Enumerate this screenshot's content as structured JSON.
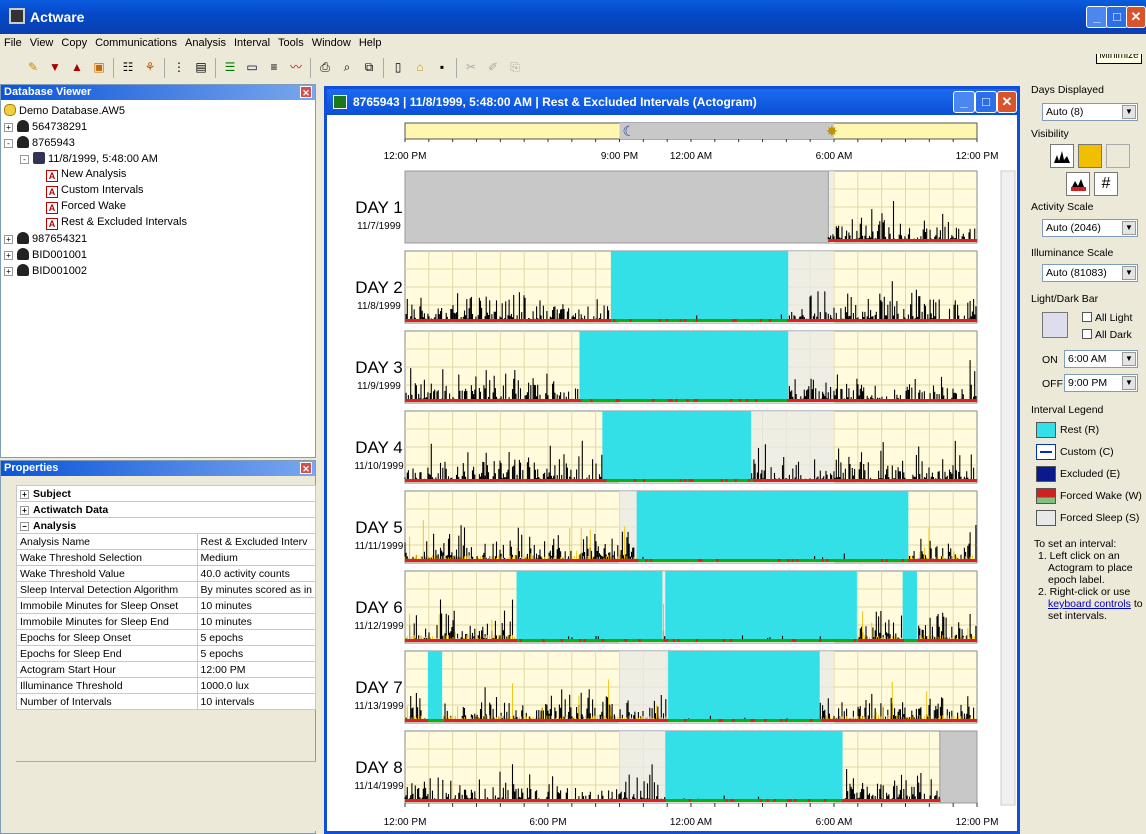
{
  "app": {
    "title": "Actware",
    "tooltip": "Minimize"
  },
  "menu": [
    "File",
    "View",
    "Copy",
    "Communications",
    "Analysis",
    "Interval",
    "Tools",
    "Window",
    "Help"
  ],
  "toolbar_icons": [
    "subject-icon",
    "download-icon",
    "upload-icon",
    "battery-icon",
    "properties-icon",
    "filter-icon",
    "tree-icon",
    "report-icon",
    "actogram-icon",
    "window-icon",
    "list-icon",
    "graph-icon",
    "print-icon",
    "print-preview-icon",
    "copy-icon",
    "new-icon",
    "open-icon",
    "save-icon",
    "cut-icon",
    "edit-icon",
    "paste-icon"
  ],
  "database_viewer": {
    "title": "Database Viewer",
    "root": "Demo Database.AW5",
    "items": [
      {
        "label": "564738291",
        "level": 1,
        "expander": "+"
      },
      {
        "label": "8765943",
        "level": 1,
        "expander": "-"
      },
      {
        "label": "11/8/1999, 5:48:00 AM",
        "level": 2,
        "expander": "-"
      },
      {
        "label": "New Analysis",
        "level": 3
      },
      {
        "label": "Custom Intervals",
        "level": 3
      },
      {
        "label": "Forced Wake",
        "level": 3
      },
      {
        "label": "Rest & Excluded Intervals",
        "level": 3,
        "selected": true
      },
      {
        "label": "987654321",
        "level": 1,
        "expander": "+"
      },
      {
        "label": "BID001001",
        "level": 1,
        "expander": "+"
      },
      {
        "label": "BID001002",
        "level": 1,
        "expander": "+"
      }
    ]
  },
  "properties": {
    "title": "Properties",
    "sections": [
      "Subject",
      "Actiwatch Data",
      "Analysis"
    ],
    "rows": [
      [
        "Analysis Name",
        "Rest & Excluded Interv"
      ],
      [
        "Wake Threshold Selection",
        "Medium"
      ],
      [
        "Wake Threshold Value",
        "40.0 activity counts"
      ],
      [
        "Sleep Interval Detection Algorithm",
        "By minutes scored as in"
      ],
      [
        "Immobile Minutes for Sleep Onset",
        "10 minutes"
      ],
      [
        "Immobile Minutes for Sleep End",
        "10 minutes"
      ],
      [
        "Epochs for Sleep Onset",
        "5 epochs"
      ],
      [
        "Epochs for Sleep End",
        "5 epochs"
      ],
      [
        "Actogram Start Hour",
        "12:00 PM"
      ],
      [
        "Illuminance Threshold",
        "1000.0 lux"
      ],
      [
        "Number of Intervals",
        "10 intervals"
      ]
    ]
  },
  "actogram": {
    "title": "8765943 | 11/8/1999, 5:48:00 AM | Rest & Excluded Intervals (Actogram)",
    "top_ticks": [
      "12:00 PM",
      "9:00 PM",
      "12:00 AM",
      "6:00 AM",
      "12:00 PM"
    ],
    "bottom_ticks": [
      "12:00 PM",
      "6:00 PM",
      "12:00 AM",
      "6:00 AM",
      "12:00 PM"
    ],
    "days": [
      {
        "label": "DAY 1",
        "date": "11/7/1999",
        "excluded": [
          [
            0,
            0.74
          ]
        ],
        "rest": []
      },
      {
        "label": "DAY 2",
        "date": "11/8/1999",
        "excluded": [],
        "rest": [
          [
            0.36,
            0.67
          ]
        ]
      },
      {
        "label": "DAY 3",
        "date": "11/9/1999",
        "excluded": [],
        "rest": [
          [
            0.305,
            0.67
          ]
        ]
      },
      {
        "label": "DAY 4",
        "date": "11/10/1999",
        "excluded": [],
        "rest": [
          [
            0.345,
            0.605
          ]
        ]
      },
      {
        "label": "DAY 5",
        "date": "11/11/1999",
        "excluded": [],
        "rest": [
          [
            0.405,
            0.88
          ]
        ]
      },
      {
        "label": "DAY 6",
        "date": "11/12/1999",
        "excluded": [],
        "rest": [
          [
            0.195,
            0.45
          ],
          [
            0.455,
            0.79
          ],
          [
            0.87,
            0.895
          ]
        ]
      },
      {
        "label": "DAY 7",
        "date": "11/13/1999",
        "excluded": [],
        "rest": [
          [
            0.04,
            0.065
          ],
          [
            0.46,
            0.725
          ]
        ]
      },
      {
        "label": "DAY 8",
        "date": "11/14/1999",
        "excluded": [
          [
            0.935,
            1.0
          ]
        ],
        "rest": [
          [
            0.455,
            0.765
          ]
        ]
      }
    ]
  },
  "right_panel": {
    "days_displayed_label": "Days Displayed",
    "days_displayed_value": "Auto (8)",
    "visibility_label": "Visibility",
    "activity_scale_label": "Activity Scale",
    "activity_scale_value": "Auto (2046)",
    "illuminance_scale_label": "Illuminance Scale",
    "illuminance_scale_value": "Auto (81083)",
    "light_dark_label": "Light/Dark Bar",
    "all_light": "All Light",
    "all_dark": "All Dark",
    "on_label": "ON",
    "on_value": "6:00 AM",
    "off_label": "OFF",
    "off_value": "9:00 PM",
    "legend_label": "Interval Legend",
    "legend": [
      {
        "name": "Rest (R)",
        "color": "#33e0e8"
      },
      {
        "name": "Custom (C)",
        "color": "#ffffff"
      },
      {
        "name": "Excluded (E)",
        "color": "#0a1a8c"
      },
      {
        "name": "Forced Wake (W)",
        "color": "#d02020"
      },
      {
        "name": "Forced Sleep (S)",
        "color": "#e8e8e8"
      }
    ],
    "help_title": "To set an interval:",
    "help_1": "1. Left click on an Actogram to place epoch label.",
    "help_2a": "2. Right-click or use",
    "help_link": "keyboard controls",
    "help_2b": "to set intervals."
  },
  "colors": {
    "rest": "#33e0e8",
    "excluded": "#c8c8c8",
    "plot_bg": "#fffbdc",
    "activity": "#000000",
    "light": "#f0c000",
    "wake_bar": "#e02020",
    "sleep_bar": "#10b010"
  }
}
